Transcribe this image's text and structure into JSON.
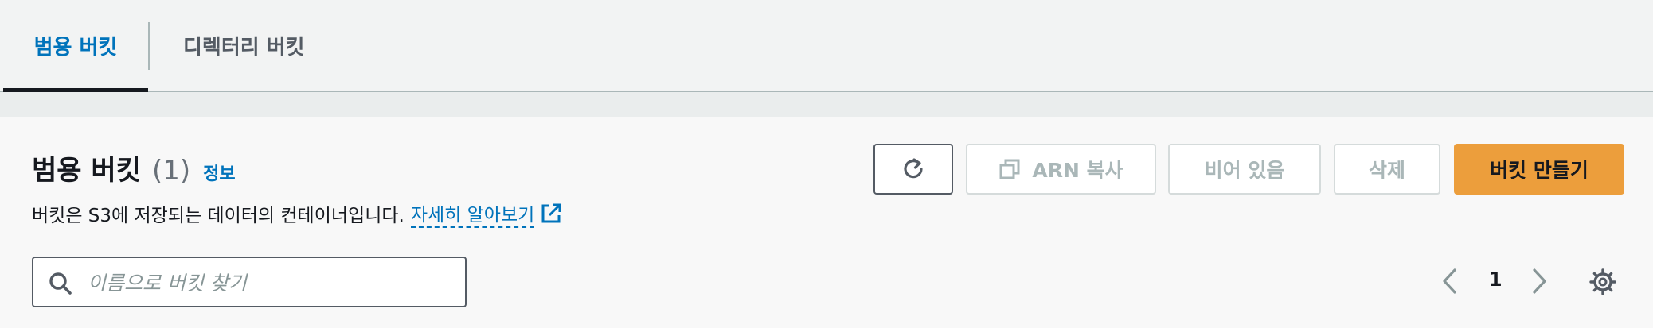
{
  "tabs": [
    {
      "label": "범용 버킷",
      "active": true
    },
    {
      "label": "디렉터리 버킷",
      "active": false
    }
  ],
  "header": {
    "title": "범용 버킷",
    "count": "(1)",
    "info_link": "정보",
    "description": "버킷은 S3에 저장되는 데이터의 컨테이너입니다.",
    "learn_more": "자세히 알아보기"
  },
  "actions": {
    "refresh_icon": "refresh-icon",
    "copy_arn": "ARN 복사",
    "empty": "비어 있음",
    "delete": "삭제",
    "create": "버킷 만들기"
  },
  "search": {
    "placeholder": "이름으로 버킷 찾기",
    "value": ""
  },
  "pagination": {
    "current_page": "1"
  },
  "colors": {
    "accent": "#0073bb",
    "primary_button": "#ec9e3c",
    "disabled": "#aab7b8"
  }
}
